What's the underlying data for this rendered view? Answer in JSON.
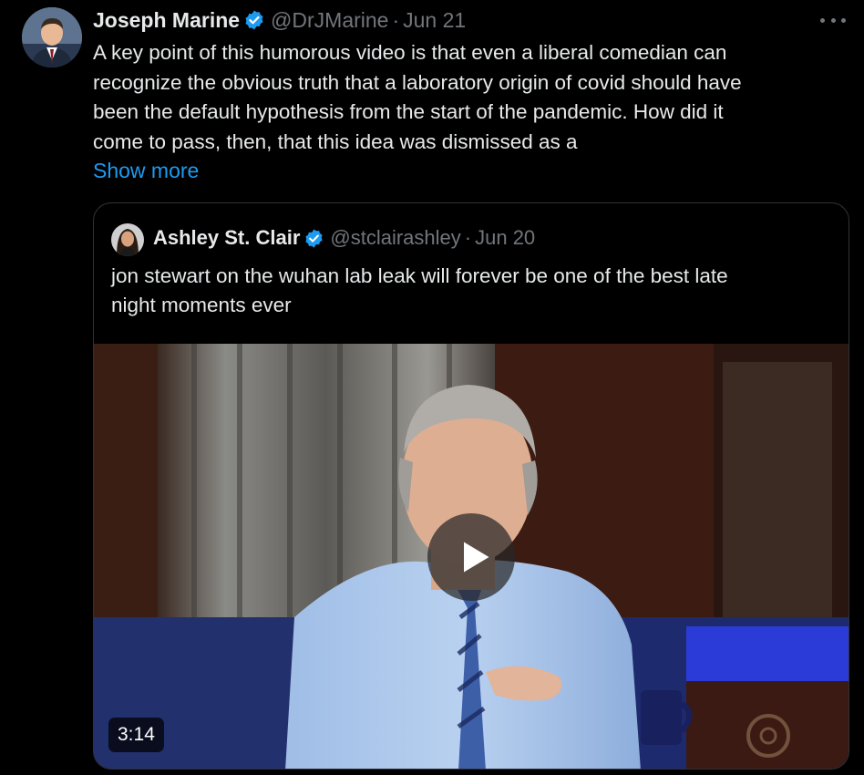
{
  "tweet": {
    "author_name": "Joseph Marine",
    "handle": "@DrJMarine",
    "separator": "·",
    "date": "Jun 21",
    "text_lines": [
      "A key point of this humorous video is that even a liberal comedian can",
      "recognize the obvious truth that a laboratory origin of covid should have",
      "been the default hypothesis from the start of the pandemic. How did it",
      "come to pass, then, that this idea was dismissed as a"
    ],
    "show_more": "Show more"
  },
  "quote": {
    "author_name": "Ashley St. Clair",
    "handle": "@stclairashley",
    "separator": "·",
    "date": "Jun 20",
    "text_lines": [
      "jon stewart on the wuhan lab leak will forever be one of the best late",
      "night moments ever"
    ],
    "video": {
      "duration": "3:14"
    }
  },
  "colors": {
    "background": "#000000",
    "text": "#e7e9ea",
    "secondary": "#71767b",
    "link": "#1d9bf0",
    "verified": "#1d9bf0",
    "border": "#2f3336"
  },
  "icons": {
    "verified": "verified-badge-icon",
    "more": "more-options-icon",
    "play": "play-icon"
  }
}
